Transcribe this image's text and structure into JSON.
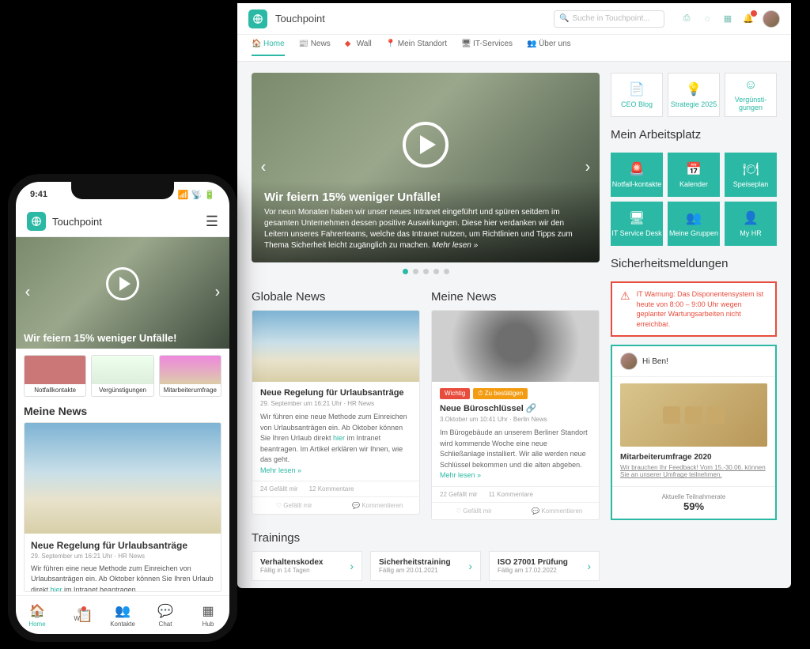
{
  "app": {
    "name": "Touchpoint"
  },
  "search": {
    "placeholder": "Suche in Touchpoint..."
  },
  "nav": {
    "home": "Home",
    "news": "News",
    "wall": "Wall",
    "standort": "Mein Standort",
    "itservices": "IT-Services",
    "ueberuns": "Über uns"
  },
  "hero": {
    "title": "Wir feiern 15% weniger Unfälle!",
    "body": "Vor neun Monaten haben wir unser neues Intranet eingeführt und spüren seitdem im gesamten Unternehmen dessen positive Auswirkungen. Diese hier verdanken wir den Leitern unseres Fahrerteams, welche das Intranet nutzen, um Richtlinien und Tipps zum Thema Sicherheit leicht zugänglich zu machen.",
    "more": "Mehr lesen »"
  },
  "sections": {
    "global": "Globale News",
    "meine": "Meine News",
    "trainings": "Trainings",
    "arbeitsplatz": "Mein Arbeitsplatz",
    "sicherheit": "Sicherheitsmeldungen"
  },
  "global_news": {
    "title": "Neue Regelung für Urlaubsanträge",
    "meta": "29. September um 16:21 Uhr · HR News",
    "body": "Wir führen eine neue Methode zum Einreichen von Urlaubsanträgen ein. Ab Oktober können Sie Ihren Urlaub direkt ",
    "hier": "hier",
    "body2": " im Intranet beantragen. Im Artikel erklären wir Ihnen, wie das geht.",
    "more": "Mehr lesen »",
    "likes": "24 Gefällt mir",
    "comments": "12 Kommentare",
    "like_action": "♡ Gefällt mir",
    "comment_action": "💬 Kommentieren"
  },
  "meine_news": {
    "tag_wichtig": "Wichtig",
    "tag_bestaetigen": "⏱ Zu bestätigen",
    "title": "Neue Büroschlüssel 🔗",
    "meta": "3.Oktober um 10:41 Uhr · Berlin News",
    "body": "Im Bürogebäude an unserem Berliner Standort wird kommende Woche eine neue Schließanlage installiert. Wir alle werden neue Schlüssel bekommen und die alten abgeben.",
    "more": "Mehr lesen »",
    "likes": "22 Gefällt mir",
    "comments": "11 Kommentare"
  },
  "trainings": [
    {
      "title": "Verhaltenskodex",
      "sub": "Fällig in 14 Tagen"
    },
    {
      "title": "Sicherheitstraining",
      "sub": "Fällig am 20.01.2021"
    },
    {
      "title": "ISO 27001 Prüfung",
      "sub": "Fällig am 17.02.2022"
    }
  ],
  "quicklinks": [
    {
      "label": "CEO Blog"
    },
    {
      "label": "Strategie 2025"
    },
    {
      "label": "Vergünsti-gungen"
    }
  ],
  "arbeitsplatz": [
    {
      "label": "Notfall-kontakte"
    },
    {
      "label": "Kalender"
    },
    {
      "label": "Speiseplan"
    },
    {
      "label": "IT Service Desk"
    },
    {
      "label": "Meine Gruppen"
    },
    {
      "label": "My HR"
    }
  ],
  "alert": {
    "text": "IT Warnung: Das Disponentensystem ist heute von 8:00 – 9:00 Uhr wegen geplanter Wartungsarbeiten nicht erreichbar."
  },
  "panel": {
    "greeting": "Hi Ben!",
    "title": "Mitarbeiterumfrage 2020",
    "sub": "Wir brauchen Ihr Feedback! Vom 15.-30.06. können Sie an unserer Umfrage teilnehmen.",
    "meter_label": "Aktuelle Teilnahmerate",
    "meter_value": "59%"
  },
  "phone": {
    "time": "9:41",
    "hero_caption": "Wir feiern 15% weniger Unfälle!",
    "tiles": [
      "Notfallkontakte",
      "Vergünstigungen",
      "Mitarbeiterumfrage"
    ],
    "section": "Meine News",
    "card": {
      "title": "Neue Regelung für Urlaubsanträge",
      "meta": "29. September um 16:21 Uhr · HR News",
      "body": "Wir führen eine neue Methode zum Einreichen von Urlaubsanträgen ein. Ab Oktober können Sie Ihren Urlaub direkt ",
      "hier": "hier",
      "body2": " im Intranet beantragen."
    },
    "tabs": [
      "Home",
      "Wall",
      "Kontakte",
      "Chat",
      "Hub"
    ]
  }
}
